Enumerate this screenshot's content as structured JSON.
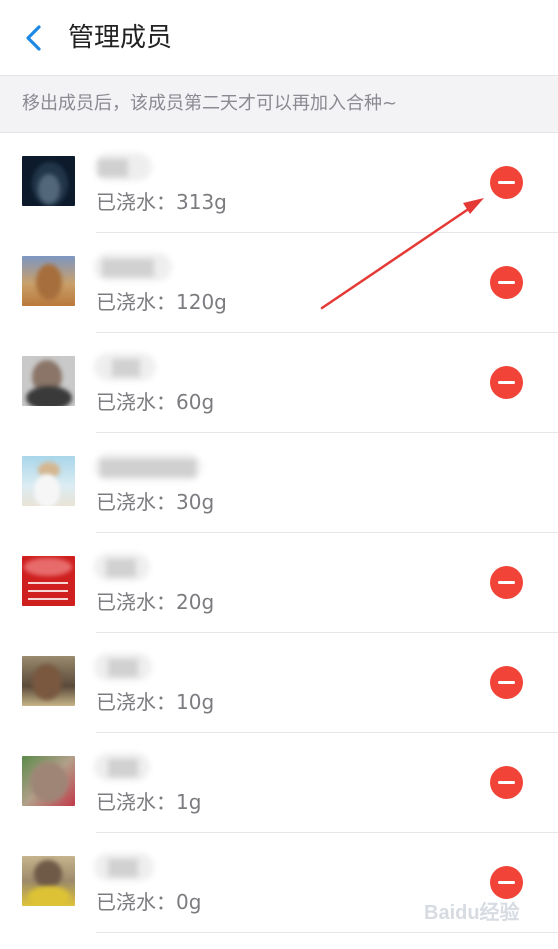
{
  "header": {
    "title": "管理成员"
  },
  "notice": {
    "text": "移出成员后，该成员第二天才可以再加入合种~"
  },
  "members": [
    {
      "watered": "已浇水：313g",
      "removable": true
    },
    {
      "watered": "已浇水：120g",
      "removable": true
    },
    {
      "watered": "已浇水：60g",
      "removable": true
    },
    {
      "watered": "已浇水：30g",
      "removable": false
    },
    {
      "watered": "已浇水：20g",
      "removable": true
    },
    {
      "watered": "已浇水：10g",
      "removable": true
    },
    {
      "watered": "已浇水：1g",
      "removable": true
    },
    {
      "watered": "已浇水：0g",
      "removable": true
    }
  ],
  "watermark": {
    "text": "Baidu经验"
  },
  "colors": {
    "accent": "#1e88e5",
    "remove": "#f24338",
    "annotation": "#e53935"
  }
}
